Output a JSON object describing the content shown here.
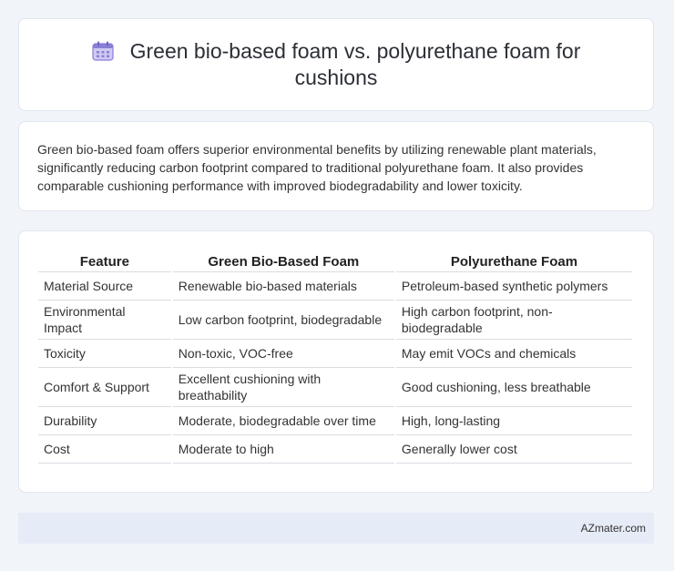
{
  "title": {
    "icon": "calendar-icon",
    "text": "Green bio-based foam vs. polyurethane foam for cushions"
  },
  "intro": "Green bio-based foam offers superior environmental benefits by utilizing renewable plant materials, significantly reducing carbon footprint compared to traditional polyurethane foam. It also provides comparable cushioning performance with improved biodegradability and lower toxicity.",
  "table": {
    "headers": [
      "Feature",
      "Green Bio-Based Foam",
      "Polyurethane Foam"
    ],
    "rows": [
      [
        "Material Source",
        "Renewable bio-based materials",
        "Petroleum-based synthetic polymers"
      ],
      [
        "Environmental Impact",
        "Low carbon footprint, biodegradable",
        "High carbon footprint, non-biodegradable"
      ],
      [
        "Toxicity",
        "Non-toxic, VOC-free",
        "May emit VOCs and chemicals"
      ],
      [
        "Comfort & Support",
        "Excellent cushioning with breathability",
        "Good cushioning, less breathable"
      ],
      [
        "Durability",
        "Moderate, biodegradable over time",
        "High, long-lasting"
      ],
      [
        "Cost",
        "Moderate to high",
        "Generally lower cost"
      ]
    ]
  },
  "footer": {
    "source": "AZmater.com"
  },
  "colors": {
    "background": "#f1f4f9",
    "card": "#ffffff",
    "footer_bg": "#e6ecf7",
    "icon_accent": "#8a7fd6"
  }
}
